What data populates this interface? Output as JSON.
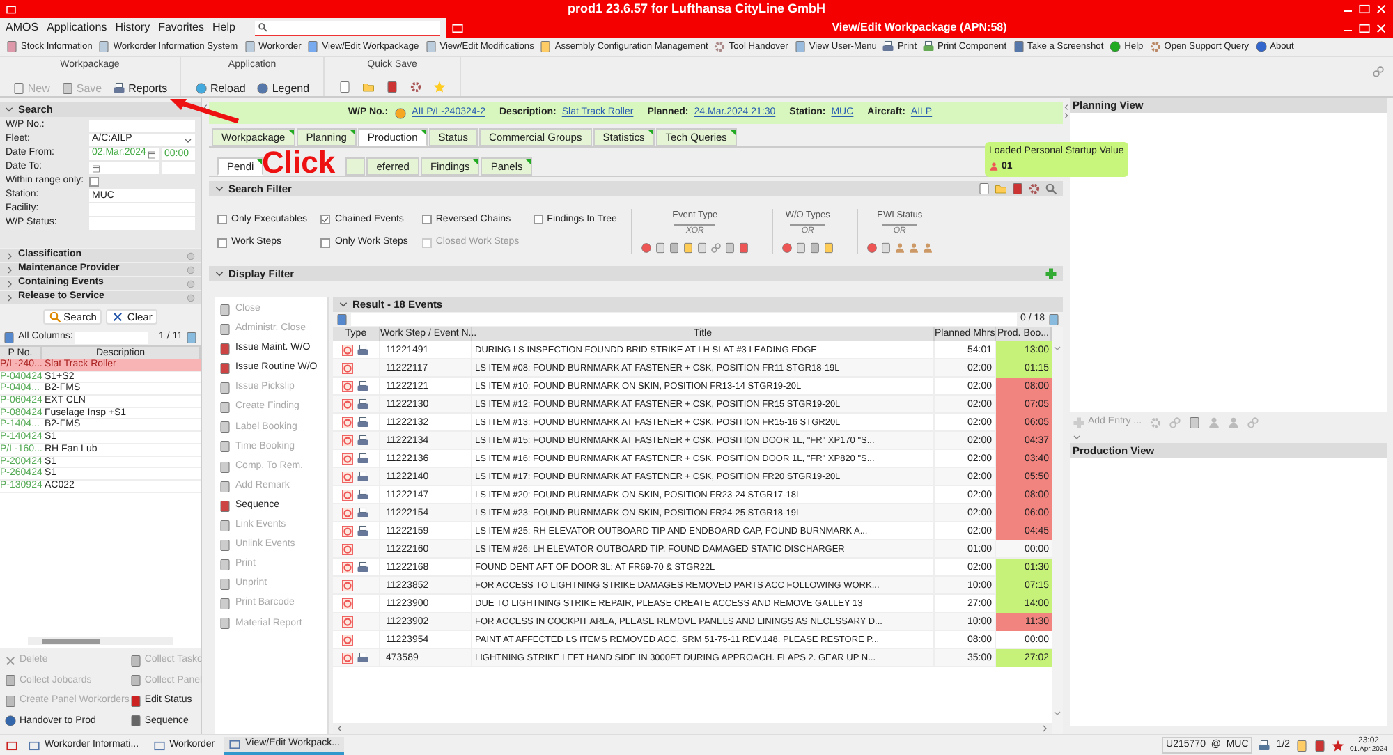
{
  "window": {
    "title": "prod1 23.6.57  for Lufthansa CityLine GmbH"
  },
  "menu": [
    "AMOS",
    "Applications",
    "History",
    "Favorites",
    "Help"
  ],
  "subwindow": {
    "title": "View/Edit Workpackage (APN:58)"
  },
  "shortcuts": [
    "Stock Information",
    "Workorder Information System",
    "Workorder",
    "View/Edit Workpackage",
    "View/Edit Modifications",
    "Assembly Configuration Management",
    "Tool Handover",
    "View User-Menu",
    "Print",
    "Print Component",
    "Take a Screenshot",
    "Help",
    "Open Support Query",
    "About"
  ],
  "ribbon": [
    {
      "title": "Workpackage",
      "buttons": [
        {
          "label": "New",
          "disabled": true
        },
        {
          "label": "Save",
          "disabled": true
        },
        {
          "label": "Reports",
          "disabled": false
        }
      ]
    },
    {
      "title": "Application",
      "buttons": [
        {
          "label": "Reload",
          "disabled": false
        },
        {
          "label": "Legend",
          "disabled": false
        }
      ]
    },
    {
      "title": "Quick Save"
    }
  ],
  "search_panel": {
    "title": "Search",
    "fields": [
      {
        "kind": "text",
        "label": "W/P No.:"
      },
      {
        "kind": "dropdown",
        "label": "Fleet:",
        "value": "A/C:AILP"
      },
      {
        "kind": "date",
        "label": "Date From:",
        "value": "02.Mar.2024",
        "time": "00:00"
      },
      {
        "kind": "date",
        "label": "Date To:"
      },
      {
        "kind": "checkbox",
        "label": "Within range only:",
        "checked": false
      },
      {
        "kind": "text",
        "label": "Station:",
        "value": "MUC"
      },
      {
        "kind": "text",
        "label": "Facility:"
      },
      {
        "kind": "text",
        "label": "W/P Status:"
      }
    ],
    "sections": [
      "Classification",
      "Maintenance Provider",
      "Containing Events",
      "Release to Service"
    ],
    "buttons": [
      "Search",
      "Clear"
    ]
  },
  "wp_list": {
    "filter_label": "All Columns:",
    "count": "1 / 11",
    "columns": [
      "P No.",
      "Description"
    ],
    "rows": [
      {
        "cells": [
          "P/L-240...",
          "Slat Track Roller"
        ],
        "selected": true
      },
      {
        "cells": [
          "P-040424",
          "S1+S2"
        ],
        "selected": false
      },
      {
        "cells": [
          "P-0404...",
          "B2-FMS"
        ],
        "selected": false
      },
      {
        "cells": [
          "P-060424",
          "EXT CLN"
        ],
        "selected": false
      },
      {
        "cells": [
          "P-080424",
          "Fuselage Insp +S1"
        ],
        "selected": false
      },
      {
        "cells": [
          "P-1404...",
          "B2-FMS"
        ],
        "selected": false
      },
      {
        "cells": [
          "P-140424",
          "S1"
        ],
        "selected": false
      },
      {
        "cells": [
          "P/L-160...",
          "RH Fan Lub"
        ],
        "selected": false
      },
      {
        "cells": [
          "P-200424",
          "S1"
        ],
        "selected": false
      },
      {
        "cells": [
          "P-260424",
          "S1"
        ],
        "selected": false
      },
      {
        "cells": [
          "P-130924",
          "AC022"
        ],
        "selected": false
      }
    ]
  },
  "wp_actions": [
    {
      "label": "Delete",
      "disabled": true
    },
    {
      "label": "Collect Taskc",
      "disabled": true
    },
    {
      "label": "Collect Jobcards",
      "disabled": true
    },
    {
      "label": "Collect Panel",
      "disabled": true
    },
    {
      "label": "Create Panel Workorders",
      "disabled": true
    },
    {
      "label": "Edit Status",
      "disabled": false
    },
    {
      "label": "Handover to Prod",
      "disabled": false
    },
    {
      "label": "Sequence",
      "disabled": false
    }
  ],
  "header": [
    {
      "label": "W/P No.:",
      "value": "AILP/L-240324-2"
    },
    {
      "label": "Description:",
      "value": "Slat Track Roller"
    },
    {
      "label": "Planned:",
      "value": "24.Mar.2024 21:30"
    },
    {
      "label": "Station:",
      "value": "MUC"
    },
    {
      "label": "Aircraft:",
      "value": "AILP"
    }
  ],
  "tabs": [
    {
      "label": "Workpackage",
      "selected": false,
      "flagged": true
    },
    {
      "label": "Planning",
      "selected": false,
      "flagged": true
    },
    {
      "label": "Production",
      "selected": true,
      "flagged": true
    },
    {
      "label": "Status",
      "selected": false,
      "flagged": false
    },
    {
      "label": "Commercial Groups",
      "selected": false,
      "flagged": false
    },
    {
      "label": "Statistics",
      "selected": false,
      "flagged": true
    },
    {
      "label": "Tech Queries",
      "selected": false,
      "flagged": true
    }
  ],
  "subtabs": [
    {
      "label": "Pendi",
      "selected": true,
      "flagged": true
    },
    {
      "selected": false,
      "flagged": false
    },
    {
      "label": "eferred",
      "selected": false,
      "flagged": false
    },
    {
      "label": "Findings",
      "selected": false,
      "flagged": true
    },
    {
      "label": "Panels",
      "selected": false,
      "flagged": true
    }
  ],
  "tooltip": {
    "title": "Loaded Personal Startup Value",
    "value": "01"
  },
  "search_filter": {
    "title": "Search Filter",
    "options": [
      {
        "label": "Only Executables",
        "checked": false,
        "disabled": false
      },
      {
        "label": "Chained Events",
        "checked": true,
        "disabled": false
      },
      {
        "label": "Reversed Chains",
        "checked": false,
        "disabled": false
      },
      {
        "label": "Findings In Tree",
        "checked": false,
        "disabled": false
      },
      {
        "label": "Work Steps",
        "checked": false,
        "disabled": false
      },
      {
        "label": "Only Work Steps",
        "checked": false,
        "disabled": false
      },
      {
        "label": "Closed Work Steps",
        "checked": false,
        "disabled": true
      }
    ],
    "groups": [
      {
        "title": "Event Type",
        "mode": "XOR"
      },
      {
        "title": "W/O Types",
        "mode": "OR"
      },
      {
        "title": "EWI Status",
        "mode": "OR"
      }
    ]
  },
  "display_filter": {
    "title": "Display Filter"
  },
  "event_actions": [
    {
      "label": "Close",
      "disabled": true
    },
    {
      "label": "Administr. Close",
      "disabled": true
    },
    {
      "label": "Issue Maint. W/O",
      "disabled": false
    },
    {
      "label": "Issue Routine W/O",
      "disabled": false
    },
    {
      "label": "Issue Pickslip",
      "disabled": true
    },
    {
      "label": "Create Finding",
      "disabled": true
    },
    {
      "label": "Label Booking",
      "disabled": true
    },
    {
      "label": "Time Booking",
      "disabled": true
    },
    {
      "label": "Comp. To Rem.",
      "disabled": true
    },
    {
      "label": "Add Remark",
      "disabled": true
    },
    {
      "label": "Sequence",
      "disabled": false
    },
    {
      "label": "Link Events",
      "disabled": true
    },
    {
      "label": "Unlink Events",
      "disabled": true
    },
    {
      "label": "Print",
      "disabled": true
    },
    {
      "label": "Unprint",
      "disabled": true
    },
    {
      "label": "Print Barcode",
      "disabled": true
    },
    {
      "label": "Material Report",
      "disabled": true
    }
  ],
  "result": {
    "title": "Result - 18 Events",
    "count": "0 / 18",
    "columns": [
      "Type",
      "Work Step / Event N...",
      "Title",
      "Planned Mhrs",
      "Prod. Boo..."
    ],
    "rows": [
      {
        "printed": true,
        "number": "11221491",
        "title": "DURING LS INSPECTION FOUNDD BRID STRIKE AT LH SLAT #3 LEADING EDGE",
        "planned": "54:01",
        "booked": "13:00",
        "color": "#c6f27a"
      },
      {
        "printed": false,
        "number": "11222117",
        "title": "LS ITEM #08: FOUND BURNMARK AT FASTENER + CSK, POSITION FR11 STGR18-19L",
        "planned": "02:00",
        "booked": "01:15",
        "color": "#c6f27a"
      },
      {
        "printed": true,
        "number": "11222121",
        "title": "LS ITEM #10: FOUND BURNMARK ON SKIN, POSITION FR13-14 STGR19-20L",
        "planned": "02:00",
        "booked": "08:00",
        "color": "#f28480"
      },
      {
        "printed": true,
        "number": "11222130",
        "title": "LS ITEM #12: FOUND BURNMARK AT FASTENER + CSK, POSITION FR15 STGR19-20L",
        "planned": "02:00",
        "booked": "07:05",
        "color": "#f28480"
      },
      {
        "printed": true,
        "number": "11222132",
        "title": "LS ITEM #13: FOUND BURNMARK AT FASTENER + CSK, POSITION FR15-16 STGR20L",
        "planned": "02:00",
        "booked": "06:05",
        "color": "#f28480"
      },
      {
        "printed": true,
        "number": "11222134",
        "title": "LS ITEM #15: FOUND BURNMARK AT FASTENER + CSK, POSITION DOOR 1L, \"FR\" XP170 \"S...",
        "planned": "02:00",
        "booked": "04:37",
        "color": "#f28480"
      },
      {
        "printed": true,
        "number": "11222136",
        "title": "LS ITEM #16: FOUND BURNMARK AT FASTENER + CSK, POSITION DOOR 1L, \"FR\" XP820 \"S...",
        "planned": "02:00",
        "booked": "03:40",
        "color": "#f28480"
      },
      {
        "printed": true,
        "number": "11222140",
        "title": "LS ITEM #17: FOUND BURNMARK AT FASTENER + CSK, POSITION FR20 STGR19-20L",
        "planned": "02:00",
        "booked": "05:50",
        "color": "#f28480"
      },
      {
        "printed": true,
        "number": "11222147",
        "title": "LS ITEM #20: FOUND BURNMARK ON SKIN, POSITION FR23-24 STGR17-18L",
        "planned": "02:00",
        "booked": "08:00",
        "color": "#f28480"
      },
      {
        "printed": true,
        "number": "11222154",
        "title": "LS ITEM #23: FOUND BURNMARK ON SKIN, POSITION FR24-25 STGR18-19L",
        "planned": "02:00",
        "booked": "06:00",
        "color": "#f28480"
      },
      {
        "printed": true,
        "number": "11222159",
        "title": "LS ITEM #25: RH ELEVATOR OUTBOARD TIP AND ENDBOARD CAP, FOUND BURNMARK A...",
        "planned": "02:00",
        "booked": "04:45",
        "color": "#f28480"
      },
      {
        "printed": false,
        "number": "11222160",
        "title": "LS ITEM #26: LH ELEVATOR OUTBOARD TIP, FOUND DAMAGED STATIC DISCHARGER",
        "planned": "01:00",
        "booked": "00:00"
      },
      {
        "printed": true,
        "number": "11222168",
        "title": "FOUND DENT AFT OF DOOR 3L: AT FR69-70 & STGR22L",
        "planned": "02:00",
        "booked": "01:30",
        "color": "#c6f27a"
      },
      {
        "printed": false,
        "number": "11223852",
        "title": "FOR ACCESS TO LIGHTNING STRIKE DAMAGES REMOVED PARTS ACC FOLLOWING WORK...",
        "planned": "10:00",
        "booked": "07:15",
        "color": "#c6f27a"
      },
      {
        "printed": false,
        "number": "11223900",
        "title": "DUE TO LIGHTNING STRIKE REPAIR, PLEASE CREATE ACCESS AND REMOVE GALLEY 13",
        "planned": "27:00",
        "booked": "14:00",
        "color": "#c6f27a"
      },
      {
        "printed": false,
        "number": "11223902",
        "title": "FOR ACCESS IN COCKPIT AREA, PLEASE REMOVE PANELS AND LININGS AS NECESSARY D...",
        "planned": "10:00",
        "booked": "11:30",
        "color": "#f28480"
      },
      {
        "printed": false,
        "number": "11223954",
        "title": "PAINT AT AFFECTED LS ITEMS REMOVED ACC. SRM 51-75-11 REV.148. PLEASE RESTORE P...",
        "planned": "08:00",
        "booked": "00:00"
      },
      {
        "printed": true,
        "number": "473589",
        "title": "LIGHTNING STRIKE LEFT HAND SIDE IN 3000FT DURING APPROACH. FLAPS 2. GEAR UP N...",
        "planned": "35:00",
        "booked": "27:02",
        "color": "#c6f27a"
      }
    ]
  },
  "planning_view": {
    "title": "Planning View",
    "add_entry": "Add Entry ..."
  },
  "production_view": {
    "title": "Production View"
  },
  "annotation": {
    "text": "Click"
  },
  "taskbar": {
    "tasks": [
      {
        "label": "Workorder Informati...",
        "selected": false
      },
      {
        "label": "Workorder",
        "selected": false
      },
      {
        "label": "View/Edit Workpack...",
        "selected": true
      }
    ],
    "user": "U215770  @  MUC",
    "pages": "1/2",
    "time": "23:02",
    "date": "01.Apr.2024"
  }
}
